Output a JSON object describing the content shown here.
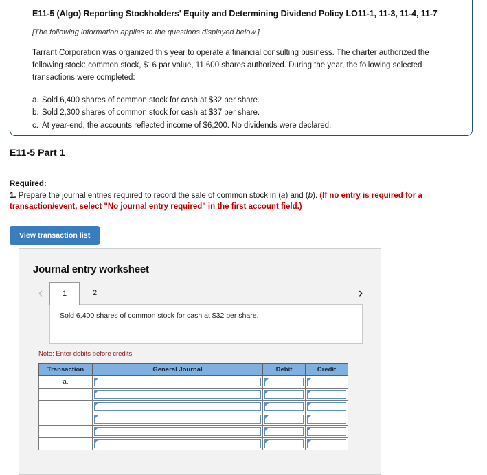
{
  "question": {
    "title": "E11-5 (Algo) Reporting Stockholders' Equity and Determining Dividend Policy LO11-1, 11-3, 11-4, 11-7",
    "applies_note": "[The following information applies to the questions displayed below.]",
    "body": "Tarrant Corporation was organized this year to operate a financial consulting business. The charter authorized the following stock: common stock, $16 par value, 11,600 shares authorized. During the year, the following selected transactions were completed:",
    "transactions": [
      {
        "mark": "a.",
        "text": "Sold 6,400 shares of common stock for cash at $32 per share."
      },
      {
        "mark": "b.",
        "text": "Sold 2,300 shares of common stock for cash at $37 per share."
      },
      {
        "mark": "c.",
        "text": "At year-end, the accounts reflected income of $6,200. No dividends were declared."
      }
    ]
  },
  "part": {
    "heading": "E11-5 Part 1"
  },
  "required": {
    "label": "Required:",
    "number": "1.",
    "text_before": " Prepare the journal entries required to record the sale of common stock in (",
    "italic_a": "a",
    "text_mid": ") and (",
    "italic_b": "b",
    "text_after": "). ",
    "red_text": "(If no entry is required for a transaction/event, select \"No journal entry required\" in the first account field.)"
  },
  "toolbar": {
    "view_transaction_list_label": "View transaction list"
  },
  "worksheet": {
    "title": "Journal entry worksheet",
    "prev_arrow": "‹",
    "next_arrow": "›",
    "tabs": [
      {
        "label": "1",
        "active": true
      },
      {
        "label": "2",
        "active": false
      }
    ],
    "transaction_description": "Sold 6,400 shares of common stock for cash at $32 per share.",
    "note": "Note: Enter debits before credits.",
    "table": {
      "headers": [
        "Transaction",
        "General Journal",
        "Debit",
        "Credit"
      ],
      "rows": [
        {
          "transaction": "a.",
          "general_journal": "",
          "debit": "",
          "credit": ""
        },
        {
          "transaction": "",
          "general_journal": "",
          "debit": "",
          "credit": ""
        },
        {
          "transaction": "",
          "general_journal": "",
          "debit": "",
          "credit": ""
        },
        {
          "transaction": "",
          "general_journal": "",
          "debit": "",
          "credit": ""
        },
        {
          "transaction": "",
          "general_journal": "",
          "debit": "",
          "credit": ""
        },
        {
          "transaction": "",
          "general_journal": "",
          "debit": "",
          "credit": ""
        }
      ]
    }
  },
  "colors": {
    "question_border": "#1f4e8c",
    "button_blue": "#3a7dbe",
    "table_header_blue": "#7fb0e0",
    "red_instruction": "#c00000",
    "note_red": "#8b1a1a",
    "panel_gray": "#f2f2f2"
  }
}
